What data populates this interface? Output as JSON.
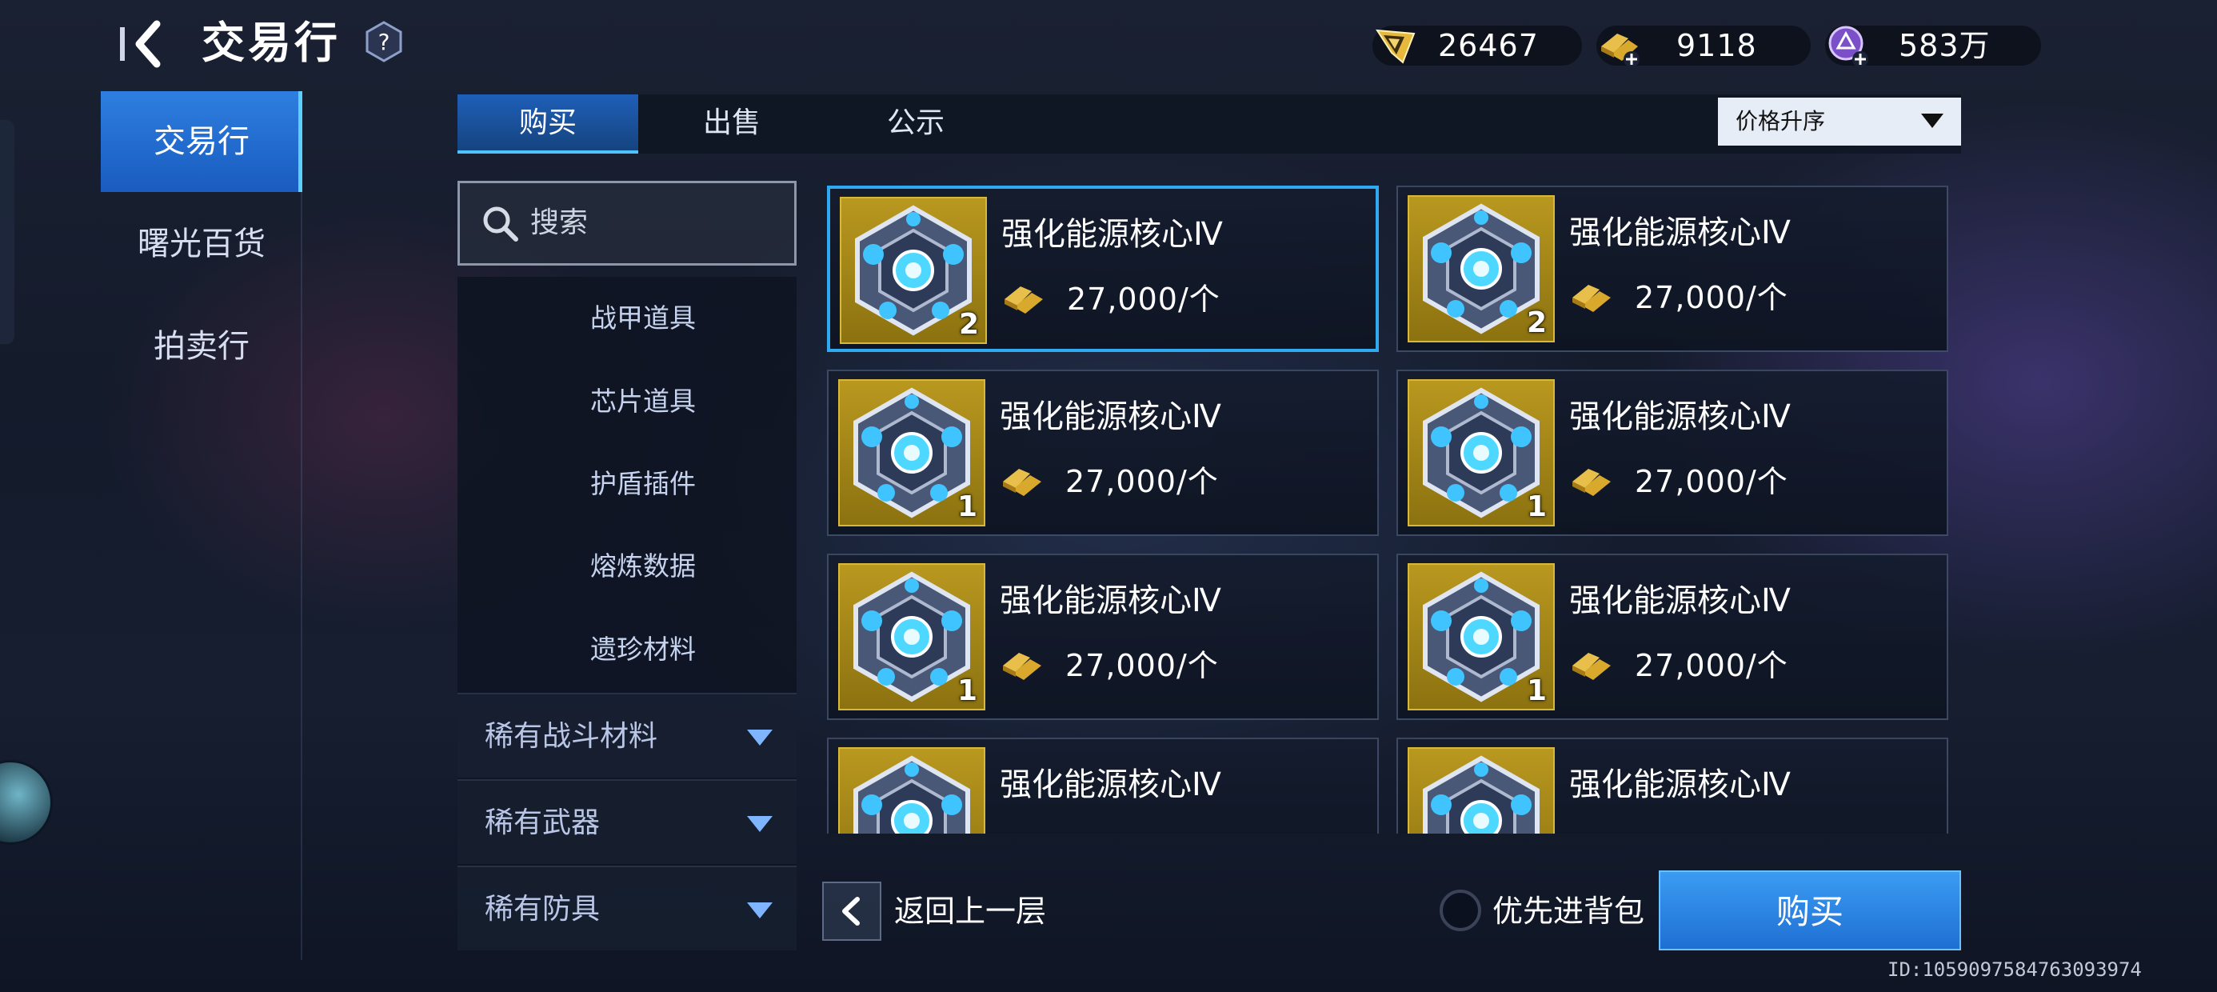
{
  "header": {
    "title": "交易行",
    "help_label": "?"
  },
  "currencies": [
    {
      "icon": "credit-ticket-icon",
      "value": "26467"
    },
    {
      "icon": "gold-bars-add-icon",
      "value": "9118"
    },
    {
      "icon": "purple-orb-add-icon",
      "value": "583万"
    }
  ],
  "sidebar": {
    "items": [
      {
        "label": "交易行",
        "active": true
      },
      {
        "label": "曙光百货",
        "active": false
      },
      {
        "label": "拍卖行",
        "active": false
      }
    ]
  },
  "tabs": [
    {
      "label": "购买",
      "active": true
    },
    {
      "label": "出售",
      "active": false
    },
    {
      "label": "公示",
      "active": false
    }
  ],
  "sort": {
    "selected": "价格升序"
  },
  "search": {
    "placeholder": "搜索"
  },
  "categories": {
    "sub_items": [
      "战甲道具",
      "芯片道具",
      "护盾插件",
      "熔炼数据",
      "遗珍材料"
    ],
    "groups": [
      "稀有战斗材料",
      "稀有武器",
      "稀有防具"
    ]
  },
  "listings": [
    {
      "name": "强化能源核心Ⅳ",
      "price": "27,000/个",
      "quantity": "2",
      "selected": true
    },
    {
      "name": "强化能源核心Ⅳ",
      "price": "27,000/个",
      "quantity": "2",
      "selected": false
    },
    {
      "name": "强化能源核心Ⅳ",
      "price": "27,000/个",
      "quantity": "1",
      "selected": false
    },
    {
      "name": "强化能源核心Ⅳ",
      "price": "27,000/个",
      "quantity": "1",
      "selected": false
    },
    {
      "name": "强化能源核心Ⅳ",
      "price": "27,000/个",
      "quantity": "1",
      "selected": false
    },
    {
      "name": "强化能源核心Ⅳ",
      "price": "27,000/个",
      "quantity": "1",
      "selected": false
    },
    {
      "name": "强化能源核心Ⅳ",
      "price": "",
      "quantity": "",
      "selected": false
    },
    {
      "name": "强化能源核心Ⅳ",
      "price": "",
      "quantity": "",
      "selected": false
    }
  ],
  "footer": {
    "back_label": "返回上一层",
    "priority_bag_label": "优先进背包",
    "buy_label": "购买",
    "id_text": "ID:1059097584763093974"
  },
  "colors": {
    "accent": "#2fa9f0",
    "active_nav": "#2d7fe0",
    "item_frame_gold": "#b9981f",
    "buy_button": "#1f6fd3"
  }
}
